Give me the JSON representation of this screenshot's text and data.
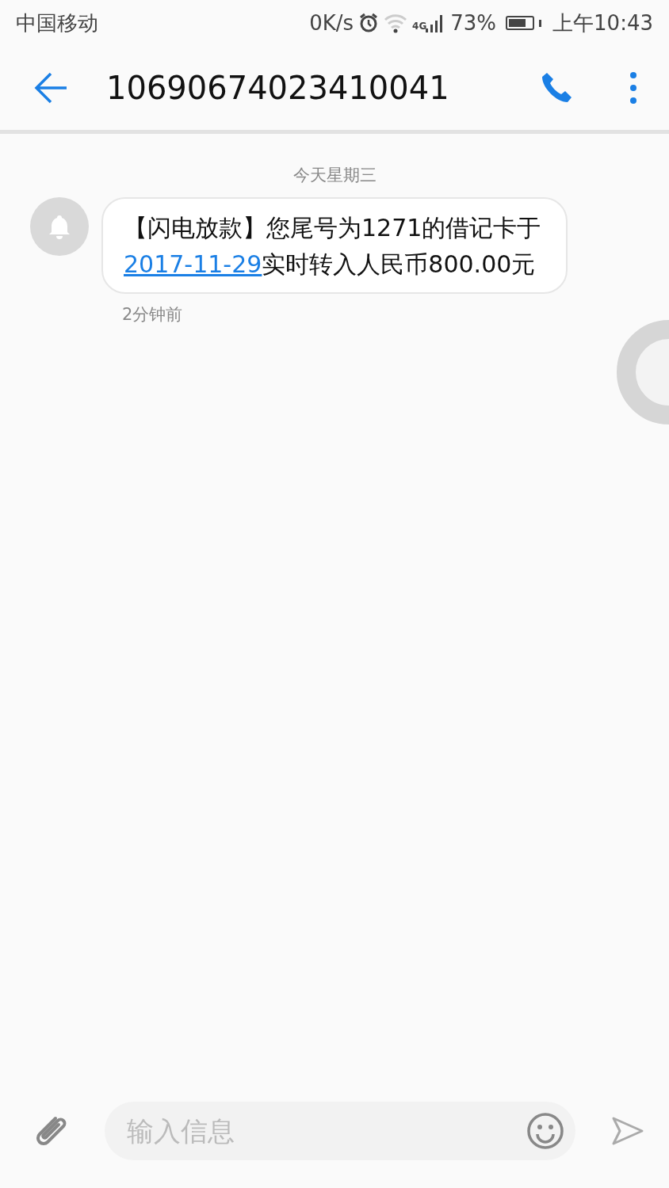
{
  "status_bar": {
    "carrier": "中国移动",
    "speed": "0K/s",
    "network": "4G",
    "battery": "73%",
    "time": "上午10:43"
  },
  "header": {
    "title": "10690674023410041"
  },
  "date_label": "今天星期三",
  "messages": [
    {
      "text_before": "【闪电放款】您尾号为1271的借记卡于",
      "link": "2017-11-29",
      "text_after": "实时转入人民币800.00元",
      "time": "2分钟前"
    }
  ],
  "composer": {
    "placeholder": "输入信息"
  }
}
